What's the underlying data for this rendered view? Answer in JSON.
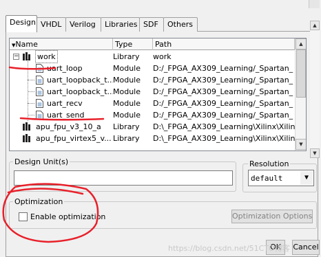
{
  "tabs": [
    {
      "label": "Design",
      "active": true
    },
    {
      "label": "VHDL",
      "active": false
    },
    {
      "label": "Verilog",
      "active": false
    },
    {
      "label": "Libraries",
      "active": false
    },
    {
      "label": "SDF",
      "active": false
    },
    {
      "label": "Others",
      "active": false
    }
  ],
  "library_list": {
    "columns": [
      "Name",
      "Type",
      "Path"
    ],
    "rows": [
      {
        "name": "work",
        "type": "Library",
        "path": "work",
        "kind": "library",
        "expanded": true,
        "level": 0
      },
      {
        "name": "uart_loop",
        "type": "Module",
        "path": "D:/_FPGA_AX309_Learning/_Spartan_",
        "kind": "module",
        "level": 1
      },
      {
        "name": "uart_loopback_t...",
        "type": "Module",
        "path": "D:/_FPGA_AX309_Learning/_Spartan_",
        "kind": "module",
        "level": 1
      },
      {
        "name": "uart_loopback_t...",
        "type": "Module",
        "path": "D:/_FPGA_AX309_Learning/_Spartan_",
        "kind": "module",
        "level": 1
      },
      {
        "name": "uart_recv",
        "type": "Module",
        "path": "D:/_FPGA_AX309_Learning/_Spartan_",
        "kind": "module",
        "level": 1
      },
      {
        "name": "uart_send",
        "type": "Module",
        "path": "D:/_FPGA_AX309_Learning/_Spartan_",
        "kind": "module",
        "level": 1
      },
      {
        "name": "apu_fpu_v3_10_a",
        "type": "Library",
        "path": "D:\\_FPGA_AX309_Learning\\Xilinx\\Xilin...",
        "kind": "library",
        "level": 0
      },
      {
        "name": "apu_fpu_virtex5_v...",
        "type": "Library",
        "path": "D:\\_FPGA_AX309_Learning\\Xilinx\\Xilin...",
        "kind": "library",
        "level": 0
      }
    ]
  },
  "design_unit": {
    "label": "Design Unit(s)",
    "value": ""
  },
  "resolution": {
    "label": "Resolution",
    "value": "default"
  },
  "optimization": {
    "label": "Optimization",
    "checkbox_label": "Enable optimization",
    "checked": false,
    "options_button": "Optimization Options..."
  },
  "buttons": {
    "ok": "OK",
    "cancel": "Cancel"
  },
  "watermark": "https://blog.csdn.net/51CTO博客",
  "colors": {
    "annotation": "#e8202a",
    "selection_border": "#606060"
  }
}
